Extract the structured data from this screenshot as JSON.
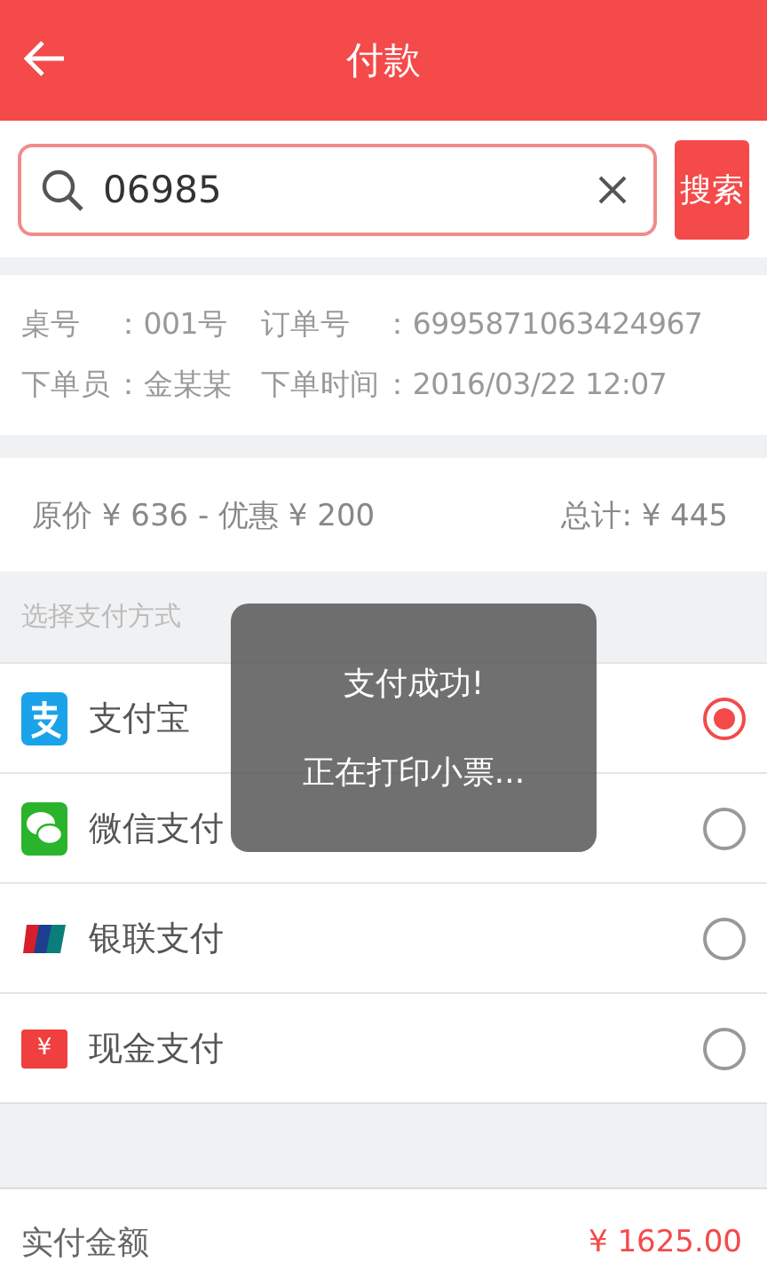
{
  "header": {
    "title": "付款"
  },
  "search": {
    "value": "06985",
    "button": "搜索"
  },
  "order_info": [
    {
      "label": "桌号",
      "value": "：001号"
    },
    {
      "label": "订单号",
      "value": "：6995871063424967"
    },
    {
      "label": "下单员",
      "value": "：金某某"
    },
    {
      "label": "下单时间",
      "value": "：2016/03/22  12:07"
    }
  ],
  "price": {
    "summary": "原价 ¥ 636 - 优惠 ¥ 200",
    "total": "总计: ¥ 445"
  },
  "section_label": "选择支付方式",
  "payment_methods": [
    {
      "kind": "alipay",
      "label": "支付宝",
      "selected": true
    },
    {
      "kind": "wechat",
      "label": "微信支付",
      "selected": false
    },
    {
      "kind": "unionpay",
      "label": "银联支付",
      "selected": false
    },
    {
      "kind": "cash",
      "label": "现金支付",
      "icon_text": "¥",
      "selected": false
    }
  ],
  "footer": {
    "label": "实付金额",
    "amount": "¥  1625.00"
  },
  "toast": {
    "title": "支付成功!",
    "message": "正在打印小票..."
  }
}
